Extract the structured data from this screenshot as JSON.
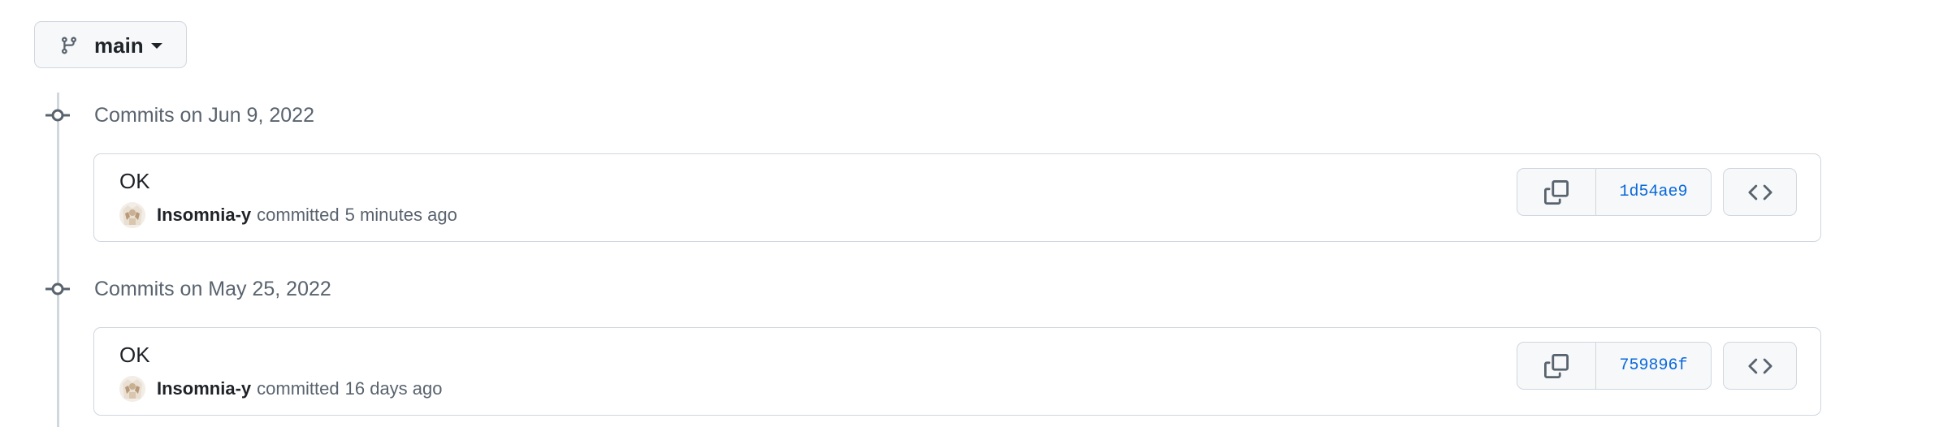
{
  "branch": {
    "name": "main",
    "icon": "git-branch-icon"
  },
  "colors": {
    "border": "#d0d7de",
    "muted_text": "#59636e",
    "link_blue": "#0969da",
    "button_bg": "#f6f8fa"
  },
  "groups": [
    {
      "title": "Commits on Jun 9, 2022",
      "commit": {
        "message": "OK",
        "author": "Insomnia-y",
        "verb": "committed",
        "time": "5 minutes ago",
        "sha": "1d54ae9"
      }
    },
    {
      "title": "Commits on May 25, 2022",
      "commit": {
        "message": "OK",
        "author": "Insomnia-y",
        "verb": "committed",
        "time": "16 days ago",
        "sha": "759896f"
      }
    }
  ],
  "icons": {
    "commit_node": "git-commit-icon",
    "copy": "copy-icon",
    "browse": "code-icon",
    "caret": "triangle-down-icon"
  }
}
